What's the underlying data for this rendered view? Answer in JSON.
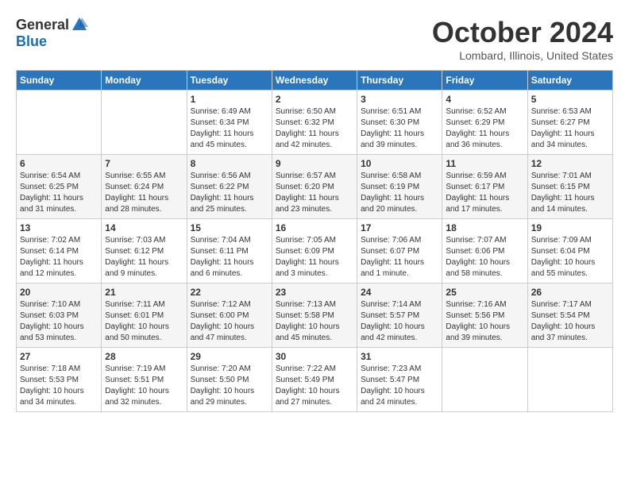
{
  "header": {
    "logo_general": "General",
    "logo_blue": "Blue",
    "month_title": "October 2024",
    "location": "Lombard, Illinois, United States"
  },
  "weekdays": [
    "Sunday",
    "Monday",
    "Tuesday",
    "Wednesday",
    "Thursday",
    "Friday",
    "Saturday"
  ],
  "weeks": [
    [
      {
        "day": "",
        "info": ""
      },
      {
        "day": "",
        "info": ""
      },
      {
        "day": "1",
        "info": "Sunrise: 6:49 AM\nSunset: 6:34 PM\nDaylight: 11 hours and 45 minutes."
      },
      {
        "day": "2",
        "info": "Sunrise: 6:50 AM\nSunset: 6:32 PM\nDaylight: 11 hours and 42 minutes."
      },
      {
        "day": "3",
        "info": "Sunrise: 6:51 AM\nSunset: 6:30 PM\nDaylight: 11 hours and 39 minutes."
      },
      {
        "day": "4",
        "info": "Sunrise: 6:52 AM\nSunset: 6:29 PM\nDaylight: 11 hours and 36 minutes."
      },
      {
        "day": "5",
        "info": "Sunrise: 6:53 AM\nSunset: 6:27 PM\nDaylight: 11 hours and 34 minutes."
      }
    ],
    [
      {
        "day": "6",
        "info": "Sunrise: 6:54 AM\nSunset: 6:25 PM\nDaylight: 11 hours and 31 minutes."
      },
      {
        "day": "7",
        "info": "Sunrise: 6:55 AM\nSunset: 6:24 PM\nDaylight: 11 hours and 28 minutes."
      },
      {
        "day": "8",
        "info": "Sunrise: 6:56 AM\nSunset: 6:22 PM\nDaylight: 11 hours and 25 minutes."
      },
      {
        "day": "9",
        "info": "Sunrise: 6:57 AM\nSunset: 6:20 PM\nDaylight: 11 hours and 23 minutes."
      },
      {
        "day": "10",
        "info": "Sunrise: 6:58 AM\nSunset: 6:19 PM\nDaylight: 11 hours and 20 minutes."
      },
      {
        "day": "11",
        "info": "Sunrise: 6:59 AM\nSunset: 6:17 PM\nDaylight: 11 hours and 17 minutes."
      },
      {
        "day": "12",
        "info": "Sunrise: 7:01 AM\nSunset: 6:15 PM\nDaylight: 11 hours and 14 minutes."
      }
    ],
    [
      {
        "day": "13",
        "info": "Sunrise: 7:02 AM\nSunset: 6:14 PM\nDaylight: 11 hours and 12 minutes."
      },
      {
        "day": "14",
        "info": "Sunrise: 7:03 AM\nSunset: 6:12 PM\nDaylight: 11 hours and 9 minutes."
      },
      {
        "day": "15",
        "info": "Sunrise: 7:04 AM\nSunset: 6:11 PM\nDaylight: 11 hours and 6 minutes."
      },
      {
        "day": "16",
        "info": "Sunrise: 7:05 AM\nSunset: 6:09 PM\nDaylight: 11 hours and 3 minutes."
      },
      {
        "day": "17",
        "info": "Sunrise: 7:06 AM\nSunset: 6:07 PM\nDaylight: 11 hours and 1 minute."
      },
      {
        "day": "18",
        "info": "Sunrise: 7:07 AM\nSunset: 6:06 PM\nDaylight: 10 hours and 58 minutes."
      },
      {
        "day": "19",
        "info": "Sunrise: 7:09 AM\nSunset: 6:04 PM\nDaylight: 10 hours and 55 minutes."
      }
    ],
    [
      {
        "day": "20",
        "info": "Sunrise: 7:10 AM\nSunset: 6:03 PM\nDaylight: 10 hours and 53 minutes."
      },
      {
        "day": "21",
        "info": "Sunrise: 7:11 AM\nSunset: 6:01 PM\nDaylight: 10 hours and 50 minutes."
      },
      {
        "day": "22",
        "info": "Sunrise: 7:12 AM\nSunset: 6:00 PM\nDaylight: 10 hours and 47 minutes."
      },
      {
        "day": "23",
        "info": "Sunrise: 7:13 AM\nSunset: 5:58 PM\nDaylight: 10 hours and 45 minutes."
      },
      {
        "day": "24",
        "info": "Sunrise: 7:14 AM\nSunset: 5:57 PM\nDaylight: 10 hours and 42 minutes."
      },
      {
        "day": "25",
        "info": "Sunrise: 7:16 AM\nSunset: 5:56 PM\nDaylight: 10 hours and 39 minutes."
      },
      {
        "day": "26",
        "info": "Sunrise: 7:17 AM\nSunset: 5:54 PM\nDaylight: 10 hours and 37 minutes."
      }
    ],
    [
      {
        "day": "27",
        "info": "Sunrise: 7:18 AM\nSunset: 5:53 PM\nDaylight: 10 hours and 34 minutes."
      },
      {
        "day": "28",
        "info": "Sunrise: 7:19 AM\nSunset: 5:51 PM\nDaylight: 10 hours and 32 minutes."
      },
      {
        "day": "29",
        "info": "Sunrise: 7:20 AM\nSunset: 5:50 PM\nDaylight: 10 hours and 29 minutes."
      },
      {
        "day": "30",
        "info": "Sunrise: 7:22 AM\nSunset: 5:49 PM\nDaylight: 10 hours and 27 minutes."
      },
      {
        "day": "31",
        "info": "Sunrise: 7:23 AM\nSunset: 5:47 PM\nDaylight: 10 hours and 24 minutes."
      },
      {
        "day": "",
        "info": ""
      },
      {
        "day": "",
        "info": ""
      }
    ]
  ]
}
